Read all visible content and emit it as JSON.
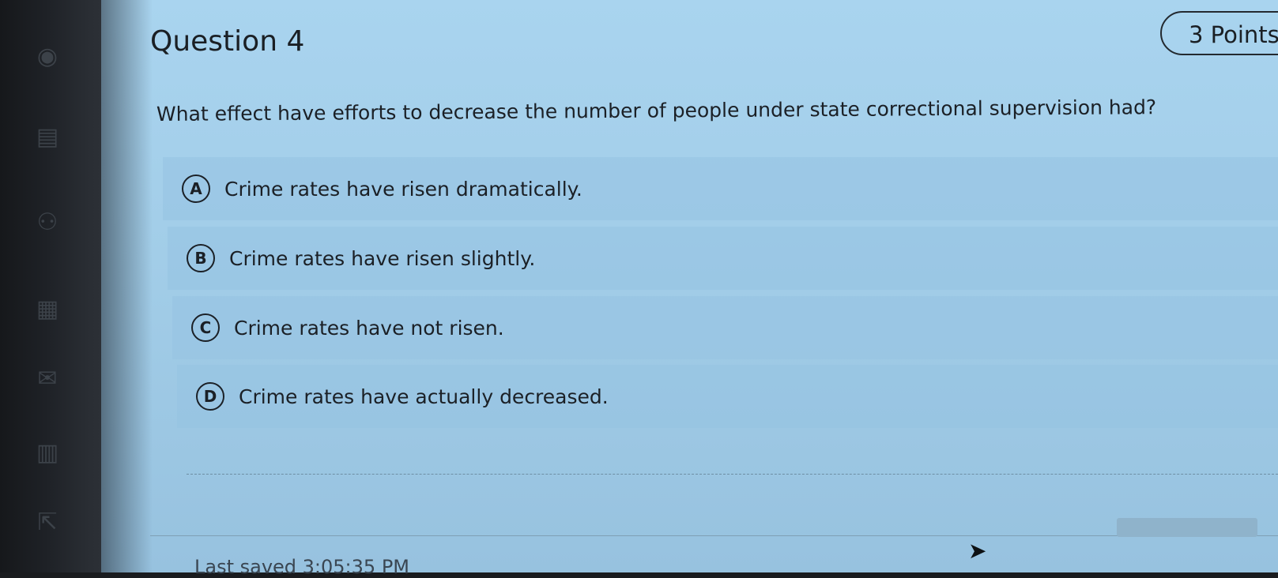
{
  "question": {
    "title": "Question 4",
    "points": "3 Points",
    "text": "What effect have efforts to decrease the number of people under state correctional supervision had?"
  },
  "options": [
    {
      "letter": "A",
      "text": "Crime rates have risen dramatically."
    },
    {
      "letter": "B",
      "text": "Crime rates have risen slightly."
    },
    {
      "letter": "C",
      "text": "Crime rates have not risen."
    },
    {
      "letter": "D",
      "text": "Crime rates have actually decreased."
    }
  ],
  "footer": {
    "last_saved": "Last saved 3:05:35 PM"
  },
  "icons": {
    "sidebar": [
      "globe-icon",
      "book-icon",
      "people-icon",
      "calendar-icon",
      "mail-icon",
      "document-icon",
      "export-icon"
    ],
    "cursor": "mouse-pointer-icon"
  }
}
